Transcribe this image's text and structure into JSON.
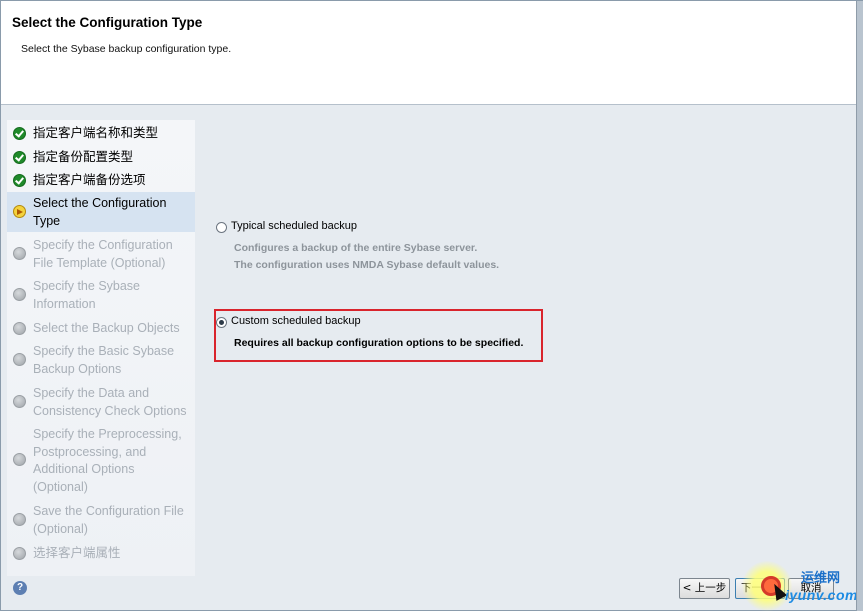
{
  "header": {
    "title": "Select the Configuration Type",
    "subtitle": "Select the Sybase backup configuration type."
  },
  "steps": [
    {
      "label": "指定客户端名称和类型",
      "status": "done"
    },
    {
      "label": "指定备份配置类型",
      "status": "done"
    },
    {
      "label": "指定客户端备份选项",
      "status": "done"
    },
    {
      "label_lines": [
        "Select the Configuration",
        "Type"
      ],
      "status": "current"
    },
    {
      "label_lines": [
        "Specify the Configuration",
        "File Template (Optional)"
      ],
      "status": "pending"
    },
    {
      "label_lines": [
        "Specify the Sybase",
        "Information"
      ],
      "status": "pending"
    },
    {
      "label": "Select the Backup Objects",
      "status": "pending"
    },
    {
      "label_lines": [
        "Specify the Basic Sybase",
        "Backup Options"
      ],
      "status": "pending"
    },
    {
      "label_lines": [
        "Specify the Data and",
        "Consistency Check Options"
      ],
      "status": "pending"
    },
    {
      "label_lines": [
        "Specify the Preprocessing,",
        "Postprocessing, and",
        "Additional Options",
        "(Optional)"
      ],
      "status": "pending"
    },
    {
      "label_lines": [
        "Save the Configuration File",
        "(Optional)"
      ],
      "status": "pending"
    },
    {
      "label": "选择客户端属性",
      "status": "pending"
    }
  ],
  "options": {
    "typical": {
      "label": "Typical scheduled backup",
      "desc1": "Configures a backup of the entire Sybase server.",
      "desc2": "The configuration uses NMDA Sybase default values.",
      "selected": false
    },
    "custom": {
      "label": "Custom scheduled backup",
      "desc": "Requires all backup configuration options to be specified.",
      "selected": true
    }
  },
  "help": {
    "label": "?"
  },
  "buttons": {
    "back": "< 上一步",
    "next": "下一步",
    "cancel": "取消"
  },
  "watermark": {
    "top": "运维网",
    "bottom": "iyunv.com"
  },
  "colors": {
    "highlight_border": "#d9242c",
    "done_icon": "#1f8a2a",
    "current_icon": "#f4d23c"
  }
}
